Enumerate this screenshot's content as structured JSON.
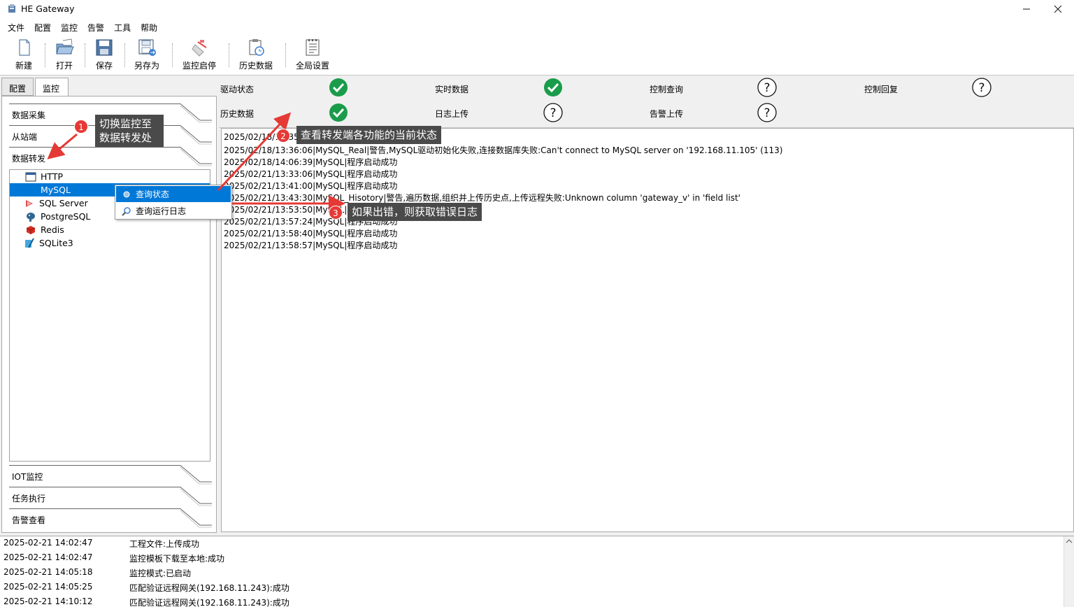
{
  "app": {
    "title": "HE Gateway"
  },
  "menu": [
    "文件",
    "配置",
    "监控",
    "告警",
    "工具",
    "帮助"
  ],
  "toolbar": {
    "new": "新建",
    "open": "打开",
    "save": "保存",
    "save_as": "另存为",
    "monitor_toggle": "监控启停",
    "history": "历史数据",
    "global_settings": "全局设置"
  },
  "left_tabs": {
    "config": "配置",
    "monitor": "监控"
  },
  "sections": {
    "data_collect": "数据采集",
    "slave": "从站端",
    "data_forward": "数据转发",
    "iot": "IOT监控",
    "task": "任务执行",
    "alarm_view": "告警查看"
  },
  "tree": [
    "HTTP",
    "MySQL",
    "SQL Server",
    "PostgreSQL",
    "Redis",
    "SQLite3"
  ],
  "context_menu": {
    "query_status": "查询状态",
    "query_log": "查询运行日志"
  },
  "status": {
    "driver": "驱动状态",
    "realtime": "实时数据",
    "control_query": "控制查询",
    "control_reply": "控制回复",
    "history": "历史数据",
    "log_upload": "日志上传",
    "alarm_upload": "告警上传"
  },
  "logs": [
    "2025/02/18/13:35:",
    "2025/02/18/13:36:06|MySQL_Real|警告,MySQL驱动初始化失败,连接数据库失败:Can't connect to MySQL server on '192.168.11.105' (113)",
    "2025/02/18/14:06:39|MySQL|程序启动成功",
    "2025/02/21/13:33:06|MySQL|程序启动成功",
    "2025/02/21/13:41:00|MySQL|程序启动成功",
    "2025/02/21/13:43:30|MySQL_Hisotory|警告,遍历数据,组织并上传历史点,上传远程失败:Unknown column 'gateway_v' in 'field list'",
    "2025/02/21/13:53:50|MySQL|程序启动成功",
    "2025/02/21/13:57:24|MySQL|程序启动成功",
    "2025/02/21/13:58:40|MySQL|程序启动成功",
    "2025/02/21/13:58:57|MySQL|程序启动成功"
  ],
  "bottom_log": [
    {
      "time": "2025-02-21 14:02:47",
      "msg": "工程文件:上传成功"
    },
    {
      "time": "2025-02-21 14:02:47",
      "msg": "监控模板下载至本地:成功"
    },
    {
      "time": "2025-02-21 14:05:18",
      "msg": "监控模式:已启动"
    },
    {
      "time": "2025-02-21 14:05:25",
      "msg": "匹配验证远程网关(192.168.11.243):成功"
    },
    {
      "time": "2025-02-21 14:10:12",
      "msg": "匹配验证远程网关(192.168.11.243):成功"
    }
  ],
  "annotations": {
    "n1_badge": "1",
    "n1_line1": "切换监控至",
    "n1_line2": "数据转发处",
    "n2_badge": "2",
    "n2_text": "查看转发端各功能的当前状态",
    "n3_badge": "3",
    "n3_text": "如果出错，则获取错误日志"
  },
  "colors": {
    "ok_green": "#1a9c4a",
    "selection_blue": "#0078d7",
    "annotation_red": "#e53935",
    "note_bg": "#4a4a4a"
  }
}
